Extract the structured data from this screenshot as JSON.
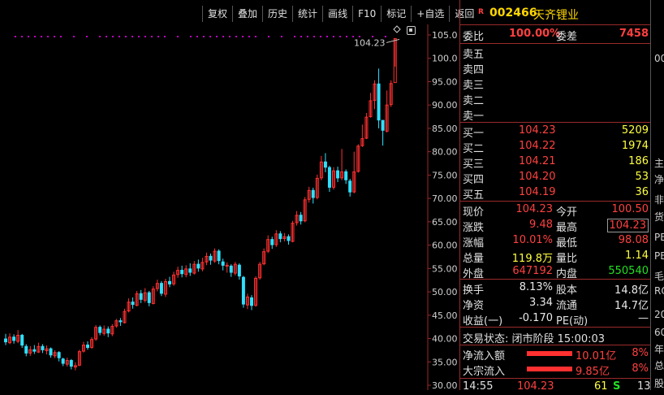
{
  "toolbar": {
    "buttons": [
      "复权",
      "叠加",
      "历史",
      "统计",
      "画线",
      "F10",
      "标记",
      "+自选",
      "返回"
    ]
  },
  "chart": {
    "price_axis": [
      "105.0",
      "100.0",
      "95.00",
      "90.00",
      "85.00",
      "80.00",
      "75.00",
      "70.00",
      "65.00",
      "60.00",
      "55.00",
      "50.00",
      "45.00",
      "40.00",
      "35.00",
      "30.00"
    ],
    "current_price_label": "104.23",
    "colors": {
      "up": "#ff3030",
      "down": "#30e0ff",
      "grid": "#9a2a2a",
      "dots": "#c000c0"
    }
  },
  "chart_data": {
    "type": "candlestick",
    "ylim": [
      30,
      105
    ],
    "candles": [
      [
        40.0,
        39.2,
        41.0,
        38.6
      ],
      [
        39.1,
        40.3,
        41.1,
        38.8
      ],
      [
        40.4,
        39.5,
        40.9,
        38.9
      ],
      [
        39.4,
        40.7,
        41.8,
        39.0
      ],
      [
        40.8,
        38.5,
        41.0,
        38.0
      ],
      [
        38.4,
        36.8,
        38.8,
        36.2
      ],
      [
        36.9,
        37.6,
        38.4,
        36.3
      ],
      [
        37.7,
        37.2,
        38.6,
        36.7
      ],
      [
        37.1,
        38.3,
        39.1,
        36.9
      ],
      [
        38.4,
        37.5,
        38.8,
        36.9
      ],
      [
        37.4,
        37.8,
        38.5,
        36.6
      ],
      [
        37.9,
        36.4,
        38.1,
        35.9
      ],
      [
        36.3,
        37.0,
        37.5,
        35.8
      ],
      [
        37.1,
        35.8,
        37.3,
        35.1
      ],
      [
        35.7,
        34.6,
        35.9,
        34.1
      ],
      [
        34.5,
        35.3,
        35.9,
        34.0
      ],
      [
        35.4,
        34.0,
        35.6,
        33.4
      ],
      [
        33.9,
        34.2,
        34.9,
        33.2
      ],
      [
        34.3,
        37.2,
        37.6,
        34.1
      ],
      [
        37.3,
        38.6,
        39.3,
        37.0
      ],
      [
        38.7,
        38.0,
        39.4,
        37.6
      ],
      [
        38.1,
        39.8,
        40.3,
        37.8
      ],
      [
        39.9,
        42.4,
        42.9,
        39.5
      ],
      [
        42.5,
        41.2,
        42.8,
        40.7
      ],
      [
        41.1,
        42.0,
        42.8,
        40.6
      ],
      [
        42.1,
        41.1,
        42.6,
        40.3
      ],
      [
        41.0,
        42.6,
        43.1,
        40.5
      ],
      [
        42.7,
        43.8,
        44.2,
        42.3
      ],
      [
        43.9,
        43.5,
        44.4,
        42.7
      ],
      [
        43.4,
        45.8,
        46.4,
        43.2
      ],
      [
        45.9,
        47.8,
        48.6,
        45.6
      ],
      [
        47.9,
        47.2,
        48.8,
        46.4
      ],
      [
        47.1,
        49.6,
        50.2,
        46.9
      ],
      [
        49.7,
        48.3,
        50.4,
        47.6
      ],
      [
        48.2,
        49.8,
        50.8,
        47.7
      ],
      [
        49.9,
        47.6,
        50.2,
        46.9
      ],
      [
        47.5,
        50.6,
        51.2,
        47.3
      ],
      [
        50.7,
        51.8,
        52.6,
        50.1
      ],
      [
        51.9,
        49.6,
        52.3,
        49.1
      ],
      [
        49.5,
        52.2,
        52.8,
        48.9
      ],
      [
        52.3,
        51.6,
        53.2,
        51.0
      ],
      [
        51.7,
        53.6,
        54.3,
        51.3
      ],
      [
        53.7,
        54.6,
        55.4,
        53.0
      ],
      [
        54.7,
        53.8,
        55.6,
        53.1
      ],
      [
        53.7,
        54.9,
        55.7,
        53.1
      ],
      [
        55.0,
        54.1,
        56.1,
        53.4
      ],
      [
        54.0,
        55.9,
        56.6,
        53.7
      ],
      [
        56.0,
        55.0,
        56.9,
        54.3
      ],
      [
        54.9,
        56.3,
        57.3,
        54.4
      ],
      [
        56.4,
        57.6,
        58.4,
        55.7
      ],
      [
        57.7,
        56.7,
        58.2,
        55.8
      ],
      [
        56.6,
        58.7,
        59.3,
        56.2
      ],
      [
        58.8,
        56.6,
        59.1,
        55.9
      ],
      [
        56.5,
        55.6,
        57.1,
        54.6
      ],
      [
        55.5,
        55.7,
        56.3,
        54.1
      ],
      [
        55.6,
        54.1,
        55.9,
        53.2
      ],
      [
        54.0,
        55.9,
        56.4,
        53.5
      ],
      [
        55.8,
        53.3,
        56.1,
        52.6
      ],
      [
        53.2,
        47.3,
        53.4,
        46.6
      ],
      [
        47.2,
        48.9,
        49.6,
        46.3
      ],
      [
        48.8,
        47.0,
        49.3,
        46.1
      ],
      [
        47.1,
        52.9,
        53.3,
        46.8
      ],
      [
        53.0,
        55.9,
        56.4,
        52.6
      ],
      [
        56.0,
        58.6,
        59.3,
        55.7
      ],
      [
        58.7,
        61.2,
        62.1,
        58.3
      ],
      [
        61.3,
        60.0,
        61.8,
        59.2
      ],
      [
        60.1,
        62.4,
        63.2,
        59.6
      ],
      [
        62.5,
        61.3,
        63.0,
        60.6
      ],
      [
        61.4,
        61.8,
        62.6,
        60.8
      ],
      [
        61.9,
        60.9,
        62.3,
        60.1
      ],
      [
        60.8,
        64.7,
        65.2,
        60.6
      ],
      [
        64.8,
        66.4,
        67.3,
        64.2
      ],
      [
        66.5,
        65.1,
        67.1,
        64.4
      ],
      [
        65.2,
        69.7,
        70.3,
        64.9
      ],
      [
        69.8,
        71.7,
        72.5,
        69.1
      ],
      [
        71.8,
        70.1,
        72.3,
        68.9
      ],
      [
        70.2,
        74.3,
        75.1,
        69.8
      ],
      [
        74.4,
        77.8,
        79.1,
        73.9
      ],
      [
        77.9,
        76.6,
        79.7,
        75.6
      ],
      [
        76.7,
        72.3,
        77.0,
        71.4
      ],
      [
        72.4,
        75.9,
        76.7,
        71.9
      ],
      [
        76.0,
        74.3,
        76.8,
        73.5
      ],
      [
        74.4,
        75.7,
        80.6,
        73.9
      ],
      [
        75.8,
        73.9,
        76.2,
        73.1
      ],
      [
        73.8,
        71.3,
        74.2,
        70.4
      ],
      [
        71.4,
        75.7,
        80.0,
        71.1
      ],
      [
        75.8,
        81.2,
        81.6,
        75.5
      ],
      [
        81.3,
        82.8,
        85.8,
        81.0
      ],
      [
        82.9,
        87.4,
        88.3,
        82.7
      ],
      [
        87.5,
        90.9,
        92.6,
        87.3
      ],
      [
        91.0,
        94.5,
        95.3,
        89.1
      ],
      [
        94.6,
        86.7,
        97.8,
        85.0
      ],
      [
        86.8,
        84.5,
        85.9,
        81.3
      ],
      [
        84.4,
        90.0,
        93.1,
        84.1
      ],
      [
        90.1,
        94.6,
        95.3,
        89.6
      ],
      [
        94.8,
        104.23,
        104.23,
        98.2
      ]
    ]
  },
  "quote": {
    "code": "002466",
    "name": "天齐锂业",
    "r_badge": "R",
    "weibi_label": "委比",
    "weibi_value": "100.00%",
    "weicha_label": "委差",
    "weicha_value": "7458",
    "sell_levels": [
      "卖五",
      "卖四",
      "卖三",
      "卖二",
      "卖一"
    ],
    "buy_levels": [
      {
        "label": "买一",
        "price": "104.23",
        "vol": "5209"
      },
      {
        "label": "买二",
        "price": "104.22",
        "vol": "1974"
      },
      {
        "label": "买三",
        "price": "104.21",
        "vol": "186"
      },
      {
        "label": "买四",
        "price": "104.20",
        "vol": "53"
      },
      {
        "label": "买五",
        "price": "104.19",
        "vol": "36"
      }
    ],
    "stats": [
      {
        "l1": "现价",
        "v1": "104.23",
        "l2": "今开",
        "v2": "100.50"
      },
      {
        "l1": "涨跌",
        "v1": "9.48",
        "l2": "最高",
        "v2": "104.23"
      },
      {
        "l1": "涨幅",
        "v1": "10.01%",
        "l2": "最低",
        "v2": "98.08"
      },
      {
        "l1": "总量",
        "v1": "119.8万",
        "l2": "量比",
        "v2": "1.14"
      },
      {
        "l1": "外盘",
        "v1": "647192",
        "l2": "内盘",
        "v2": "550540"
      }
    ],
    "fund": [
      {
        "l1": "换手",
        "v1": "8.13%",
        "l2": "股本",
        "v2": "14.8亿"
      },
      {
        "l1": "净资",
        "v1": "3.34",
        "l2": "流通",
        "v2": "14.7亿"
      },
      {
        "l1": "收益(一)",
        "v1": "-0.170",
        "l2": "PE(动)",
        "v2": "—"
      }
    ],
    "trade_status": "交易状态: 闭市阶段 15:00:03",
    "flows": [
      {
        "label": "净流入额",
        "value": "10.01亿",
        "pct": "8%"
      },
      {
        "label": "大宗流入",
        "value": "9.85亿",
        "pct": "8%"
      }
    ],
    "tick": {
      "time": "14:55",
      "price": "104.23",
      "vol": "61",
      "side": "S",
      "num": "13"
    }
  },
  "right_strip": [
    "00",
    "主",
    "净",
    "非",
    "货",
    "PE",
    "PE",
    "毛",
    "RO",
    "20",
    "60",
    "年",
    "总",
    "股"
  ]
}
